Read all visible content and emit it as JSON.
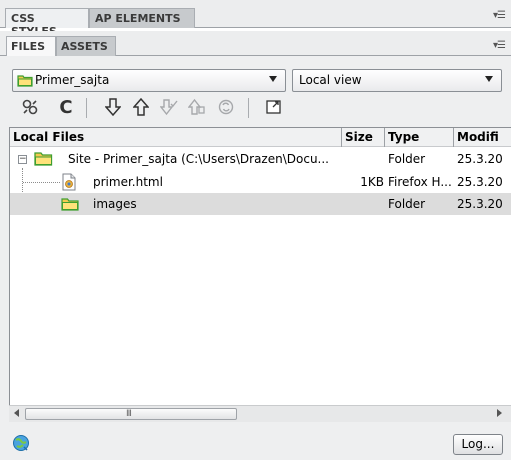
{
  "top_tabs": [
    "CSS STYLES",
    "AP ELEMENTS"
  ],
  "sub_tabs": [
    "FILES",
    "ASSETS"
  ],
  "menu_icon": "panel-menu-icon",
  "site_select": {
    "value": "Primer_sajta",
    "icon": "site-folder-icon"
  },
  "view_select": {
    "value": "Local view"
  },
  "toolbar": [
    {
      "name": "connect-icon",
      "glyph": "⚯",
      "enabled": true
    },
    {
      "name": "refresh-icon",
      "glyph": "C",
      "enabled": true
    },
    {
      "name": "get-files-icon",
      "glyph": "⇩",
      "enabled": true
    },
    {
      "name": "put-files-icon",
      "glyph": "⇧",
      "enabled": true
    },
    {
      "name": "check-out-icon",
      "glyph": "⇩",
      "enabled": false
    },
    {
      "name": "check-in-icon",
      "glyph": "⇧",
      "enabled": false
    },
    {
      "name": "synchronize-icon",
      "glyph": "⟳",
      "enabled": false
    },
    {
      "name": "expand-panel-icon",
      "glyph": "◰",
      "enabled": true
    }
  ],
  "columns": [
    "Local Files",
    "Size",
    "Type",
    "Modifi"
  ],
  "rows": [
    {
      "name": "Site - Primer_sajta (C:\\Users\\Drazen\\Docu...",
      "size": "",
      "type": "Folder",
      "modified": "25.3.20",
      "kind": "site"
    },
    {
      "name": "primer.html",
      "size": "1KB",
      "type": "Firefox H...",
      "modified": "25.3.20",
      "kind": "file"
    },
    {
      "name": "images",
      "size": "",
      "type": "Folder",
      "modified": "25.3.20",
      "kind": "folder"
    }
  ],
  "scroll_grip": "III",
  "status": {
    "log_label": "Log..."
  },
  "colors": {
    "folder": "#f3c94f",
    "folder_dark": "#3f9e2f",
    "selected_row": "#dcdcdc"
  }
}
